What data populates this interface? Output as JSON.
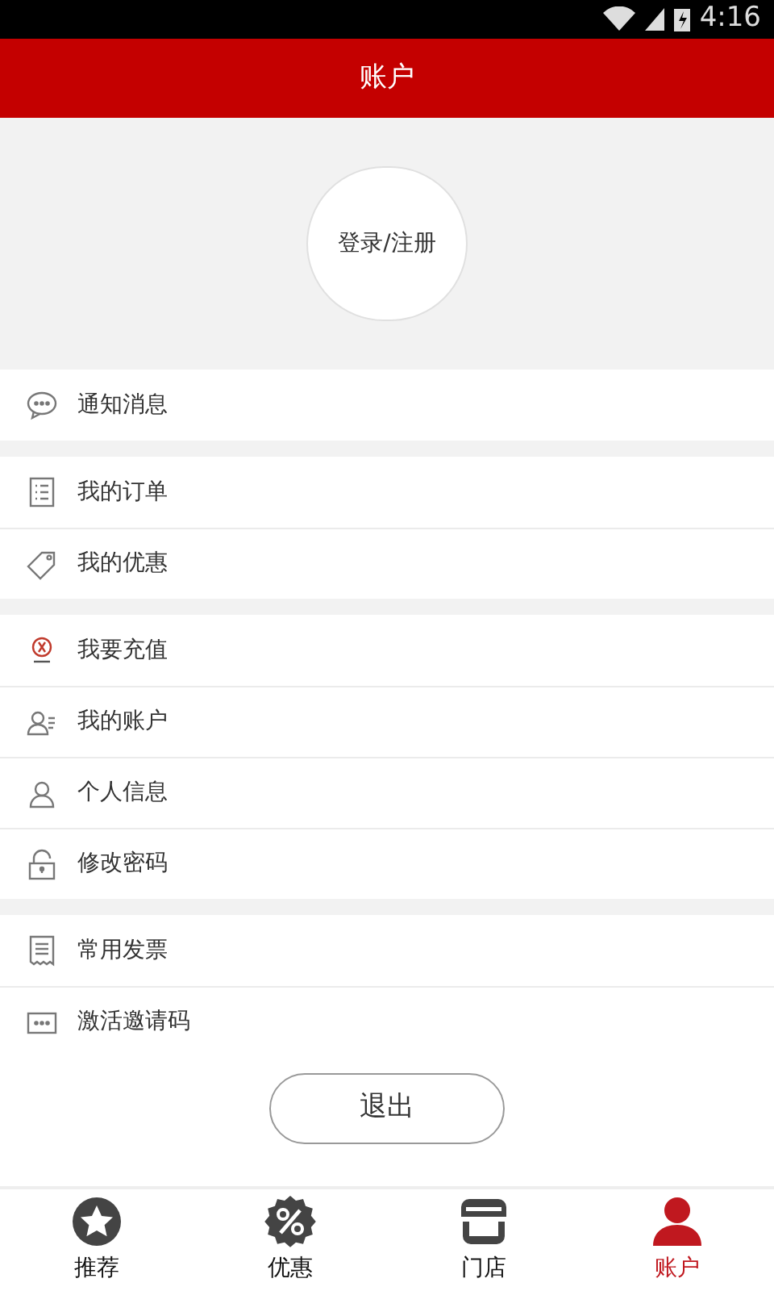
{
  "status_bar": {
    "time": "4:16"
  },
  "header": {
    "title": "账户"
  },
  "profile": {
    "login_button": "登录/注册"
  },
  "menu_groups": [
    {
      "items": [
        {
          "kind": "chat",
          "label": "通知消息"
        }
      ]
    },
    {
      "items": [
        {
          "kind": "list",
          "label": "我的订单"
        },
        {
          "kind": "tag",
          "label": "我的优惠"
        }
      ]
    },
    {
      "items": [
        {
          "kind": "logo",
          "label": "我要充值"
        },
        {
          "kind": "account",
          "label": "我的账户"
        },
        {
          "kind": "person",
          "label": "个人信息"
        },
        {
          "kind": "lock",
          "label": "修改密码"
        }
      ]
    },
    {
      "items": [
        {
          "kind": "receipt",
          "label": "常用发票"
        },
        {
          "kind": "dots",
          "label": "激活邀请码"
        }
      ]
    }
  ],
  "logout_button": "退出",
  "tabs": [
    {
      "kind": "star",
      "label": "推荐",
      "selected": false
    },
    {
      "kind": "percent",
      "label": "优惠",
      "selected": false
    },
    {
      "kind": "store",
      "label": "门店",
      "selected": false
    },
    {
      "kind": "user",
      "label": "账户",
      "selected": true
    }
  ]
}
